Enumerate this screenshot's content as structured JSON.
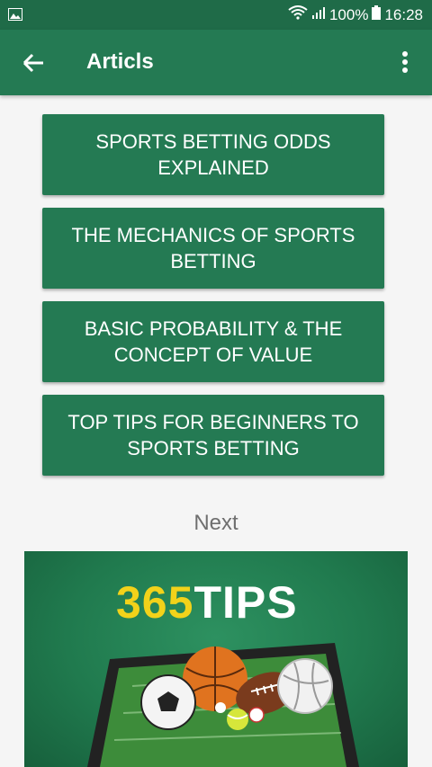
{
  "status_bar": {
    "battery": "100%",
    "time": "16:28"
  },
  "app_bar": {
    "title": "Articls"
  },
  "articles": [
    "SPORTS BETTING ODDS EXPLAINED",
    "THE MECHANICS OF SPORTS BETTING",
    "BASIC PROBABILITY & THE CONCEPT OF VALUE",
    "TOP TIPS FOR BEGINNERS TO SPORTS BETTING"
  ],
  "next_label": "Next",
  "banner": {
    "logo_number": "365",
    "logo_word": "TIPS"
  },
  "colors": {
    "primary": "#247a53",
    "status": "#1f6b48",
    "logo_yellow": "#f2d21a"
  }
}
